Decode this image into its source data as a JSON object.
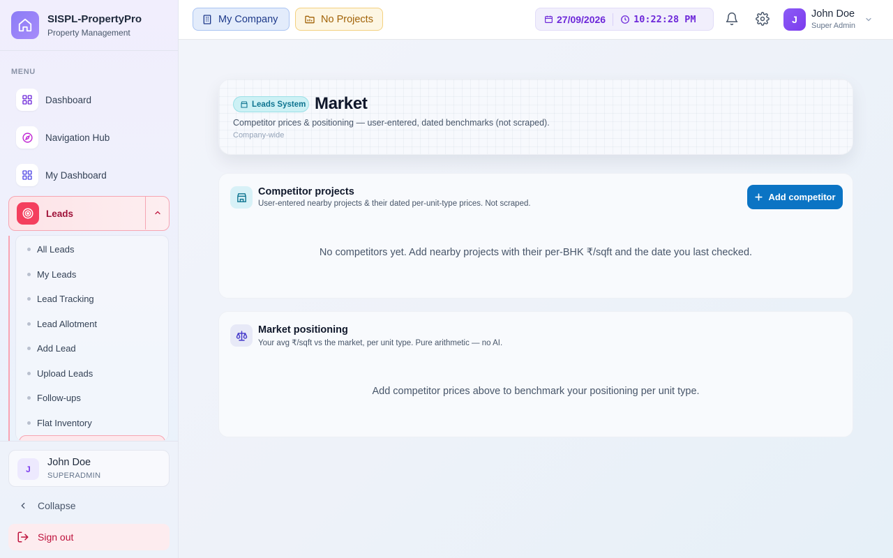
{
  "brand": {
    "name": "SISPL-PropertyPro",
    "subtitle": "Property Management"
  },
  "sidebar": {
    "menu_label": "MENU",
    "items": [
      {
        "label": "Dashboard",
        "icon": "grid-icon"
      },
      {
        "label": "Navigation Hub",
        "icon": "compass-icon"
      },
      {
        "label": "My Dashboard",
        "icon": "grid-icon"
      },
      {
        "label": "Leads",
        "icon": "target-icon",
        "expanded": true
      }
    ],
    "lead_submenu": [
      "All Leads",
      "My Leads",
      "Lead Tracking",
      "Lead Allotment",
      "Add Lead",
      "Upload Leads",
      "Follow-ups",
      "Flat Inventory"
    ],
    "user": {
      "initial": "J",
      "name": "John Doe",
      "role": "SUPERADMIN"
    },
    "collapse_label": "Collapse",
    "signout_label": "Sign out"
  },
  "header": {
    "company_label": "My Company",
    "projects_label": "No Projects",
    "date": "27/09/2026",
    "time": "10:22:28 PM",
    "user": {
      "initial": "J",
      "name": "John Doe",
      "role": "Super Admin"
    }
  },
  "page": {
    "badge": "Leads System",
    "title": "Market",
    "description": "Competitor prices & positioning — user-entered, dated benchmarks (not scraped).",
    "scope": "Company-wide"
  },
  "competitor_card": {
    "title": "Competitor projects",
    "subtitle": "User-entered nearby projects & their dated per-unit-type prices. Not scraped.",
    "button_label": "Add competitor",
    "empty_text": "No competitors yet. Add nearby projects with their per-BHK ₹/sqft and the date you last checked."
  },
  "positioning_card": {
    "title": "Market positioning",
    "subtitle": "Your avg ₹/sqft vs the market, per unit type. Pure arithmetic — no AI.",
    "empty_text": "Add competitor prices above to benchmark your positioning per unit type."
  },
  "colors": {
    "accent": "#7c3aed",
    "leads_active": "#f43f5e",
    "primary_button": "#0b74c4",
    "badge_teal": "#0e7490"
  }
}
